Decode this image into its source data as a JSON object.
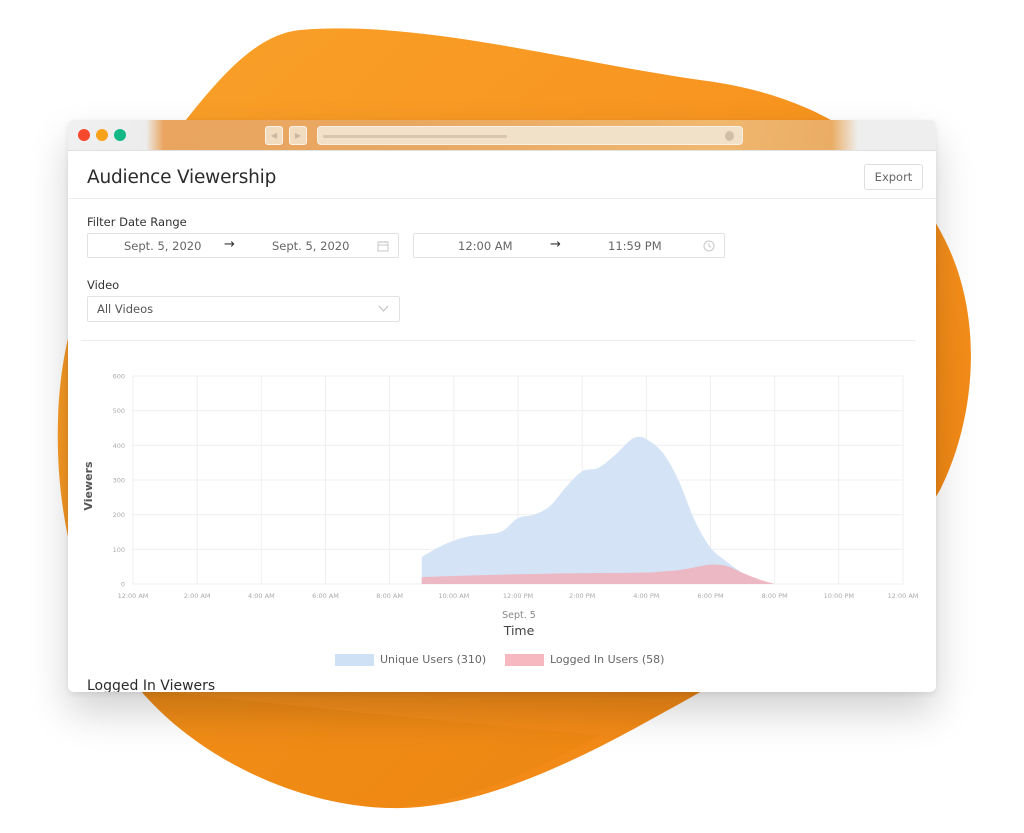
{
  "window": {
    "traffic_lights": [
      "close",
      "minimize",
      "maximize"
    ],
    "nav": {
      "back_icon": "◀",
      "forward_icon": "▶"
    }
  },
  "header": {
    "title": "Audience Viewership",
    "export_label": "Export"
  },
  "filters": {
    "date_range_label": "Filter Date Range",
    "date_start": "Sept. 5, 2020",
    "date_end": "Sept. 5, 2020",
    "time_start": "12:00 AM",
    "time_end": "11:59 PM",
    "arrow": "→",
    "video_label": "Video",
    "video_selected": "All Videos"
  },
  "section": {
    "logged_in_title": "Logged In Viewers"
  },
  "colors": {
    "unique_fill": "#cfe1f5",
    "logged_fill": "#f2b7c0",
    "grid": "#efefef",
    "brand_orange": "#f7931e"
  },
  "chart_data": {
    "type": "area",
    "title": "",
    "xlabel": "Time",
    "xlabel_sub": "Sept. 5",
    "ylabel": "Viewers",
    "ylim": [
      0,
      600
    ],
    "xlim_hours": [
      0,
      24
    ],
    "grid": true,
    "legend_position": "bottom",
    "y_ticks": [
      0,
      100,
      200,
      300,
      400,
      500,
      600
    ],
    "x_ticks": [
      {
        "h": 0,
        "label": "12:00 AM"
      },
      {
        "h": 2,
        "label": "2:00 AM"
      },
      {
        "h": 4,
        "label": "4:00 AM"
      },
      {
        "h": 6,
        "label": "6:00 AM"
      },
      {
        "h": 8,
        "label": "8:00 AM"
      },
      {
        "h": 10,
        "label": "10:00 AM"
      },
      {
        "h": 12,
        "label": "12:00 PM"
      },
      {
        "h": 14,
        "label": "2:00 PM"
      },
      {
        "h": 16,
        "label": "4:00 PM"
      },
      {
        "h": 18,
        "label": "6:00 PM"
      },
      {
        "h": 20,
        "label": "8:00 PM"
      },
      {
        "h": 22,
        "label": "10:00 PM"
      },
      {
        "h": 24,
        "label": "12:00 AM"
      }
    ],
    "series": [
      {
        "name": "Unique Users (310)",
        "color": "#cfe1f5",
        "points": [
          [
            9.0,
            78
          ],
          [
            9.5,
            105
          ],
          [
            10.0,
            125
          ],
          [
            10.5,
            138
          ],
          [
            11.0,
            143
          ],
          [
            11.5,
            152
          ],
          [
            12.0,
            190
          ],
          [
            12.5,
            200
          ],
          [
            13.0,
            225
          ],
          [
            13.5,
            280
          ],
          [
            14.0,
            325
          ],
          [
            14.5,
            335
          ],
          [
            15.0,
            370
          ],
          [
            15.5,
            415
          ],
          [
            15.75,
            424
          ],
          [
            16.0,
            418
          ],
          [
            16.5,
            380
          ],
          [
            17.0,
            300
          ],
          [
            17.5,
            185
          ],
          [
            18.0,
            105
          ],
          [
            18.5,
            65
          ],
          [
            19.0,
            32
          ],
          [
            19.5,
            10
          ],
          [
            20.0,
            0
          ]
        ]
      },
      {
        "name": "Logged In Users (58)",
        "color": "#f2b7c0",
        "points": [
          [
            9.0,
            20
          ],
          [
            10.0,
            23
          ],
          [
            11.0,
            26
          ],
          [
            12.0,
            28
          ],
          [
            13.0,
            30
          ],
          [
            14.0,
            31
          ],
          [
            15.0,
            32
          ],
          [
            16.0,
            33
          ],
          [
            16.5,
            36
          ],
          [
            17.0,
            40
          ],
          [
            17.5,
            48
          ],
          [
            18.0,
            56
          ],
          [
            18.5,
            52
          ],
          [
            19.0,
            32
          ],
          [
            19.5,
            14
          ],
          [
            20.0,
            0
          ]
        ]
      }
    ]
  }
}
